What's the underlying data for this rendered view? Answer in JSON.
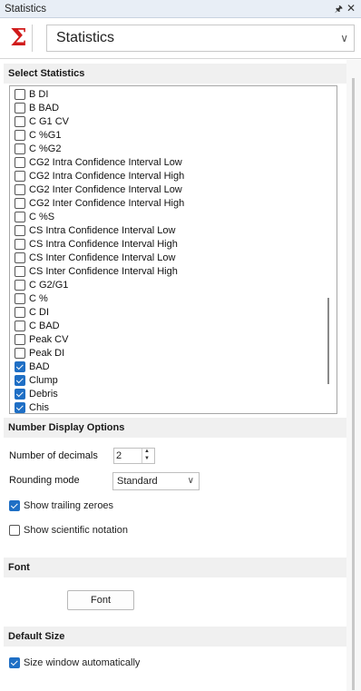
{
  "window": {
    "title": "Statistics",
    "pin_icon": "pin-icon",
    "close_icon": "close-icon"
  },
  "toolbar": {
    "icon": "sigma-icon",
    "accent": "#d01a1a",
    "selected_view": "Statistics"
  },
  "select_statistics": {
    "header": "Select Statistics",
    "items": [
      {
        "label": "B DI",
        "checked": false
      },
      {
        "label": "B BAD",
        "checked": false
      },
      {
        "label": "C G1 CV",
        "checked": false
      },
      {
        "label": "C %G1",
        "checked": false
      },
      {
        "label": "C %G2",
        "checked": false
      },
      {
        "label": "CG2 Intra Confidence Interval Low",
        "checked": false
      },
      {
        "label": "CG2 Intra Confidence Interval High",
        "checked": false
      },
      {
        "label": "CG2 Inter Confidence Interval Low",
        "checked": false
      },
      {
        "label": "CG2 Inter Confidence Interval High",
        "checked": false
      },
      {
        "label": "C %S",
        "checked": false
      },
      {
        "label": "CS Intra Confidence Interval Low",
        "checked": false
      },
      {
        "label": "CS Intra Confidence Interval High",
        "checked": false
      },
      {
        "label": "CS Inter Confidence Interval Low",
        "checked": false
      },
      {
        "label": "CS Inter Confidence Interval High",
        "checked": false
      },
      {
        "label": "C G2/G1",
        "checked": false
      },
      {
        "label": "C %",
        "checked": false
      },
      {
        "label": "C DI",
        "checked": false
      },
      {
        "label": "C BAD",
        "checked": false
      },
      {
        "label": "Peak CV",
        "checked": false
      },
      {
        "label": "Peak DI",
        "checked": false
      },
      {
        "label": "BAD",
        "checked": true
      },
      {
        "label": "Clump",
        "checked": true
      },
      {
        "label": "Debris",
        "checked": true
      },
      {
        "label": "Chis",
        "checked": true
      }
    ]
  },
  "number_display": {
    "header": "Number Display Options",
    "decimals_label": "Number of decimals",
    "decimals_value": "2",
    "rounding_label": "Rounding mode",
    "rounding_value": "Standard",
    "trailing_zeroes_label": "Show trailing zeroes",
    "trailing_zeroes_checked": true,
    "scientific_label": "Show scientific notation",
    "scientific_checked": false
  },
  "font_section": {
    "header": "Font",
    "button_label": "Font"
  },
  "default_size": {
    "header": "Default Size",
    "auto_size_label": "Size window automatically",
    "auto_size_checked": true
  },
  "colors": {
    "check_accent": "#1f6fc5",
    "titlebar": "#e8eef6",
    "section_header": "#f0f0f0"
  }
}
